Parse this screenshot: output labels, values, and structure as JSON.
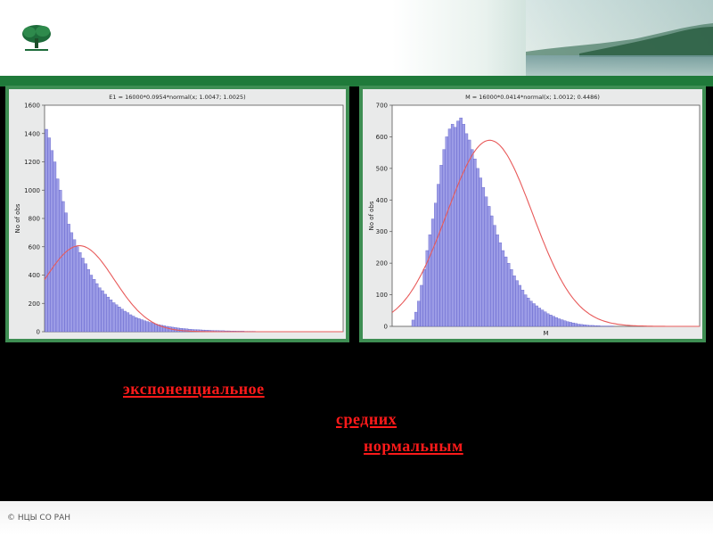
{
  "footer": {
    "text": "© НЦЫ СО РАН"
  },
  "captions": {
    "line1": "экспоненциальное",
    "line2": "средних",
    "line3": "нормальным"
  },
  "colors": {
    "background": "#000000",
    "panel_border": "#3e8e53",
    "bars": "#9c9ce6",
    "bar_edge": "#4b4bc2",
    "curve": "#e85a5a",
    "text_red": "#ff1a1a"
  },
  "chart_data": [
    {
      "type": "bar",
      "title": "E1 = 16000*0.0954*normal(x; 1.0047; 1.0025)",
      "xlabel": "",
      "ylabel": "No of obs",
      "ylim": [
        0,
        1600
      ],
      "yticks": [
        0,
        200,
        400,
        600,
        800,
        1000,
        1200,
        1400,
        1600
      ],
      "series": [
        {
          "values": [
            1430,
            1370,
            1280,
            1200,
            1080,
            1000,
            920,
            840,
            760,
            700,
            650,
            600,
            560,
            520,
            480,
            440,
            400,
            370,
            340,
            310,
            290,
            265,
            245,
            225,
            205,
            190,
            175,
            160,
            145,
            135,
            120,
            110,
            100,
            92,
            85,
            78,
            72,
            66,
            60,
            55,
            50,
            46,
            42,
            38,
            35,
            32,
            29,
            26,
            24,
            22,
            20,
            18,
            16,
            15,
            14,
            13,
            12,
            11,
            10,
            9,
            8,
            8,
            7,
            7,
            6,
            6,
            5,
            5,
            4,
            4,
            4,
            3,
            3,
            3,
            3,
            2,
            2,
            2,
            2,
            2,
            1,
            1,
            1,
            1,
            1,
            1,
            1,
            1,
            1,
            1
          ]
        }
      ],
      "fit": {
        "kind": "normal",
        "count": 16000,
        "binwidth": 0.0954,
        "mean": 1.0047,
        "sd": 1.0025,
        "xrange": [
          0,
          8.6
        ]
      }
    },
    {
      "type": "bar",
      "title": "M = 16000*0.0414*normal(x; 1.0012; 0.4486)",
      "xlabel": "M",
      "ylabel": "No of obs",
      "ylim": [
        0,
        700
      ],
      "yticks": [
        0,
        100,
        200,
        300,
        400,
        500,
        600,
        700
      ],
      "series": [
        {
          "values": [
            20,
            45,
            80,
            130,
            180,
            240,
            290,
            340,
            390,
            450,
            510,
            560,
            600,
            625,
            640,
            630,
            650,
            660,
            640,
            610,
            590,
            560,
            530,
            500,
            470,
            440,
            410,
            380,
            350,
            320,
            290,
            265,
            240,
            220,
            200,
            180,
            160,
            145,
            130,
            115,
            100,
            90,
            80,
            72,
            65,
            58,
            52,
            46,
            40,
            36,
            32,
            28,
            24,
            21,
            18,
            15,
            13,
            11,
            9,
            7,
            6,
            5,
            4,
            3,
            3,
            2,
            2,
            1,
            1,
            1,
            1,
            1
          ]
        }
      ],
      "fit": {
        "kind": "normal",
        "count": 16000,
        "binwidth": 0.0414,
        "mean": 1.0012,
        "sd": 0.4486,
        "xrange": [
          -0.02,
          3.2
        ]
      }
    }
  ]
}
